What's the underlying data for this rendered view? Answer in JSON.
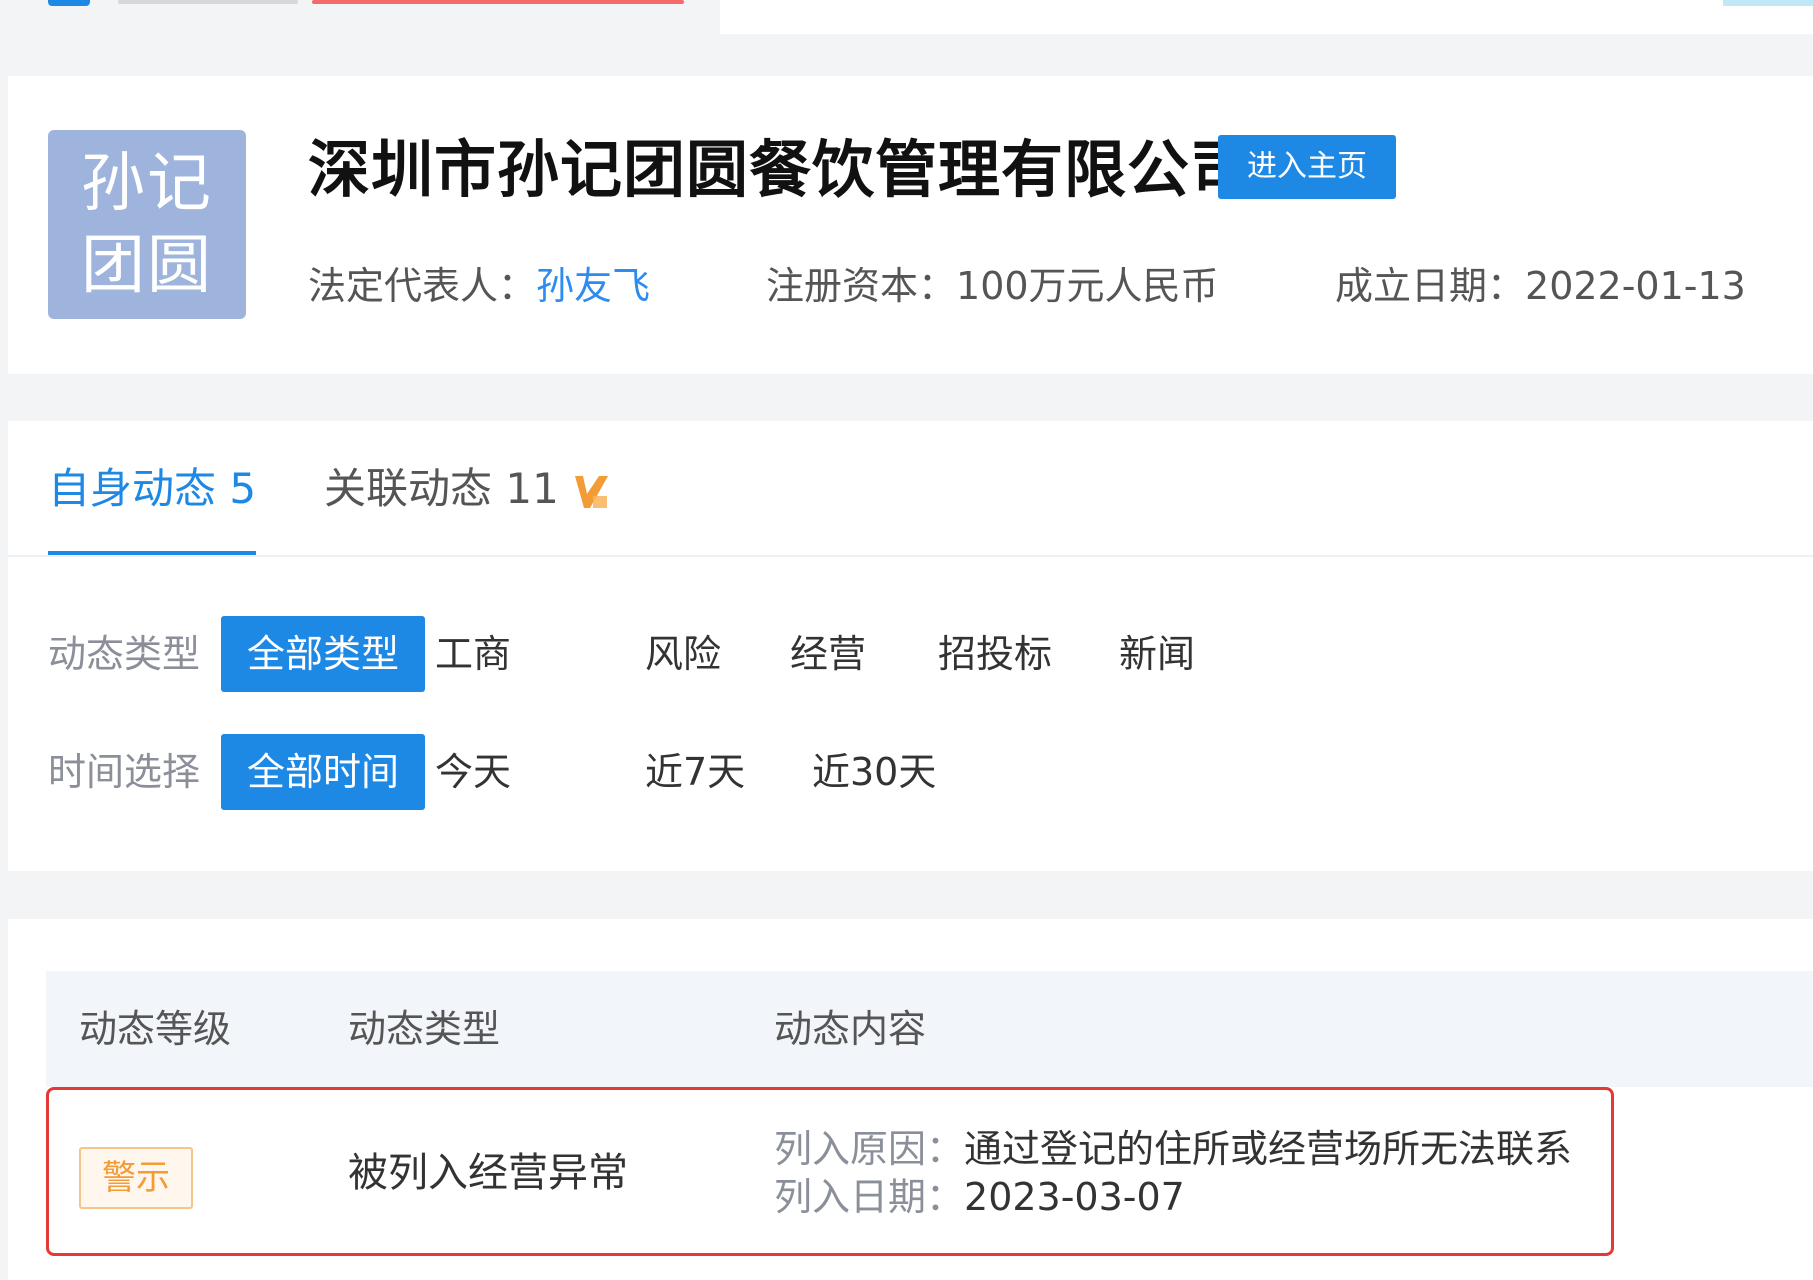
{
  "company": {
    "logo_line1": "孙记",
    "logo_line2": "团圆",
    "name": "深圳市孙记团圆餐饮管理有限公司",
    "homepage_button": "进入主页",
    "legal_rep_label": "法定代表人：",
    "legal_rep_value": "孙友飞",
    "capital_label": "注册资本：",
    "capital_value": "100万元人民币",
    "founded_label": "成立日期：",
    "founded_value": "2022-01-13"
  },
  "tabs": [
    {
      "label": "自身动态 5",
      "active": true
    },
    {
      "label": "关联动态 11",
      "active": false,
      "badge_icon": "vip-icon"
    }
  ],
  "filters": {
    "type_label": "动态类型",
    "type_options": [
      "全部类型",
      "工商",
      "风险",
      "经营",
      "招投标",
      "新闻"
    ],
    "type_selected": "全部类型",
    "time_label": "时间选择",
    "time_options": [
      "全部时间",
      "今天",
      "近7天",
      "近30天"
    ],
    "time_selected": "全部时间"
  },
  "table": {
    "headers": [
      "动态等级",
      "动态类型",
      "动态内容"
    ],
    "rows": [
      {
        "level": "警示",
        "type": "被列入经营异常",
        "reason_label": "列入原因：",
        "reason_value": "通过登记的住所或经营场所无法联系",
        "date_label": "列入日期：",
        "date_value": "2023-03-07"
      }
    ]
  },
  "colors": {
    "primary": "#1e88e5",
    "link": "#2d8cf0",
    "warning": "#f39c35",
    "highlight_border": "#e53935",
    "logo_bg": "#9eb4dd"
  }
}
